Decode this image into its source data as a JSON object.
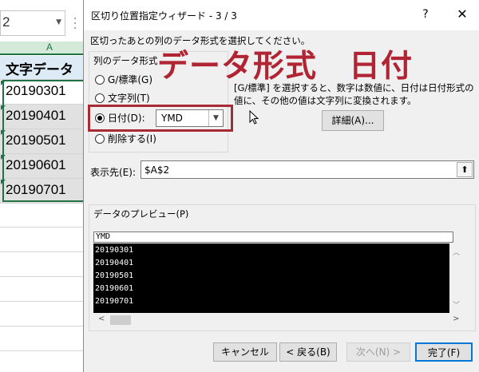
{
  "excel": {
    "name_box": "2",
    "column_letter": "A",
    "header_cell": "文字データ",
    "cells": [
      "20190301",
      "20190401",
      "20190501",
      "20190601",
      "20190701"
    ]
  },
  "dialog": {
    "title": "区切り位置指定ウィザード - 3 / 3",
    "help": "?",
    "close": "✕",
    "instruction": "区切ったあとの列のデータ形式を選択してください。",
    "group_title": "列のデータ形式",
    "radios": [
      {
        "label": "G/標準(G)",
        "selected": false
      },
      {
        "label": "文字列(T)",
        "selected": false
      },
      {
        "label": "日付(D):",
        "selected": true
      },
      {
        "label": "削除する(I)",
        "selected": false
      }
    ],
    "date_format": "YMD",
    "overlay_text": "データ形式　日付",
    "description_line1": "[G/標準] を選択すると、数字は数値に、日付は日付形式の",
    "description_line2": "値に、その他の値は文字列に変換されます。",
    "detail_button": "詳細(A)...",
    "destination_label": "表示先(E):",
    "destination_value": "$A$2",
    "preview_title": "データのプレビュー(P)",
    "preview_header": "YMD",
    "preview_rows": [
      "20190301",
      "20190401",
      "20190501",
      "20190601",
      "20190701"
    ],
    "buttons": {
      "cancel": "キャンセル",
      "back": "< 戻る(B)",
      "next": "次へ(N) >",
      "finish": "完了(F)"
    },
    "accent_red": "#a62b35"
  }
}
